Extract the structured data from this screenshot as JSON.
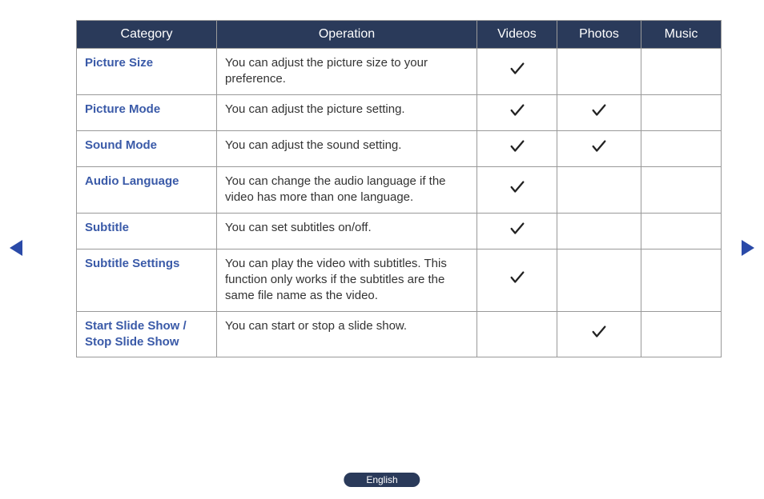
{
  "headers": {
    "category": "Category",
    "operation": "Operation",
    "videos": "Videos",
    "photos": "Photos",
    "music": "Music"
  },
  "rows": [
    {
      "category": "Picture Size",
      "operation": "You can adjust the picture size to your preference.",
      "videos": true,
      "photos": false,
      "music": false
    },
    {
      "category": "Picture Mode",
      "operation": "You can adjust the picture setting.",
      "videos": true,
      "photos": true,
      "music": false
    },
    {
      "category": "Sound Mode",
      "operation": "You can adjust the sound setting.",
      "videos": true,
      "photos": true,
      "music": false
    },
    {
      "category": "Audio Language",
      "operation": "You can change the audio language if the video has more than one language.",
      "videos": true,
      "photos": false,
      "music": false
    },
    {
      "category": "Subtitle",
      "operation": "You can set subtitles on/off.",
      "videos": true,
      "photos": false,
      "music": false
    },
    {
      "category": "Subtitle Settings",
      "operation": "You can play the video with subtitles. This function only works if the subtitles are the same file name as the video.",
      "videos": true,
      "photos": false,
      "music": false
    },
    {
      "category": "Start Slide Show / Stop Slide Show",
      "operation": "You can start or stop a slide show.",
      "videos": false,
      "photos": true,
      "music": false
    }
  ],
  "language_label": "English",
  "check_glyph": "✓"
}
